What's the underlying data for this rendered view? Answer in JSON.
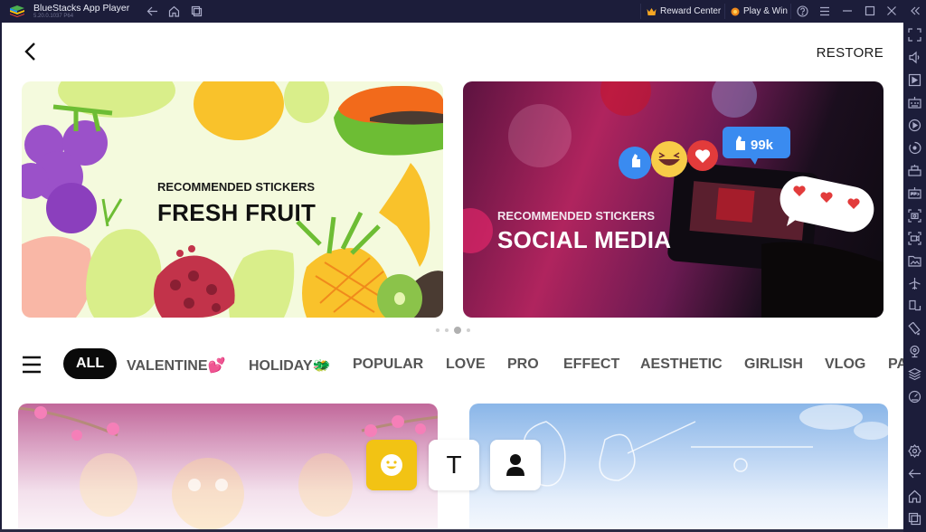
{
  "titlebar": {
    "app_name": "BlueStacks App Player",
    "version": "5.20.0.1037  P64",
    "reward_center": "Reward Center",
    "play_win": "Play & Win",
    "icons": [
      "back-icon",
      "home-icon",
      "multi-instance-icon",
      "help-icon",
      "menu-icon",
      "minimize-icon",
      "maximize-icon",
      "close-icon",
      "collapse-sidebar-icon"
    ]
  },
  "header": {
    "restore_label": "RESTORE"
  },
  "banners": [
    {
      "subtitle": "RECOMMENDED STICKERS",
      "title": "FRESH FRUIT"
    },
    {
      "subtitle": "RECOMMENDED STICKERS",
      "title": "SOCIAL MEDIA",
      "like_count": "99k"
    }
  ],
  "carousel": {
    "total": 4,
    "active_index": 2
  },
  "categories": [
    {
      "label": "ALL",
      "active": true
    },
    {
      "label": "VALENTINE💕",
      "active": false
    },
    {
      "label": "HOLIDAY🐲",
      "active": false
    },
    {
      "label": "POPULAR",
      "active": false
    },
    {
      "label": "LOVE",
      "active": false
    },
    {
      "label": "PRO",
      "active": false
    },
    {
      "label": "EFFECT",
      "active": false
    },
    {
      "label": "AESTHETIC",
      "active": false
    },
    {
      "label": "GIRLISH",
      "active": false
    },
    {
      "label": "VLOG",
      "active": false
    },
    {
      "label": "PA",
      "active": false
    }
  ],
  "floating_buttons": {
    "text_label": "T"
  },
  "sidebar_icons": [
    "fullscreen-icon",
    "volume-icon",
    "macro-icon",
    "keyboard-controls-icon",
    "record-icon",
    "rotate-icon",
    "instance-manager-icon",
    "apk-install-icon",
    "screenshot-icon",
    "screen-record-icon",
    "media-folder-icon",
    "airplane-mode-icon",
    "multi-instance-sync-icon",
    "rotate-screen-icon",
    "location-icon",
    "layers-icon",
    "performance-icon",
    "settings-icon",
    "back-icon",
    "home-icon",
    "recent-apps-icon"
  ],
  "colors": {
    "chrome_bg": "#1c1d3a",
    "accent_yellow": "#f2c314",
    "active_tab_bg": "#0a0a0a"
  }
}
